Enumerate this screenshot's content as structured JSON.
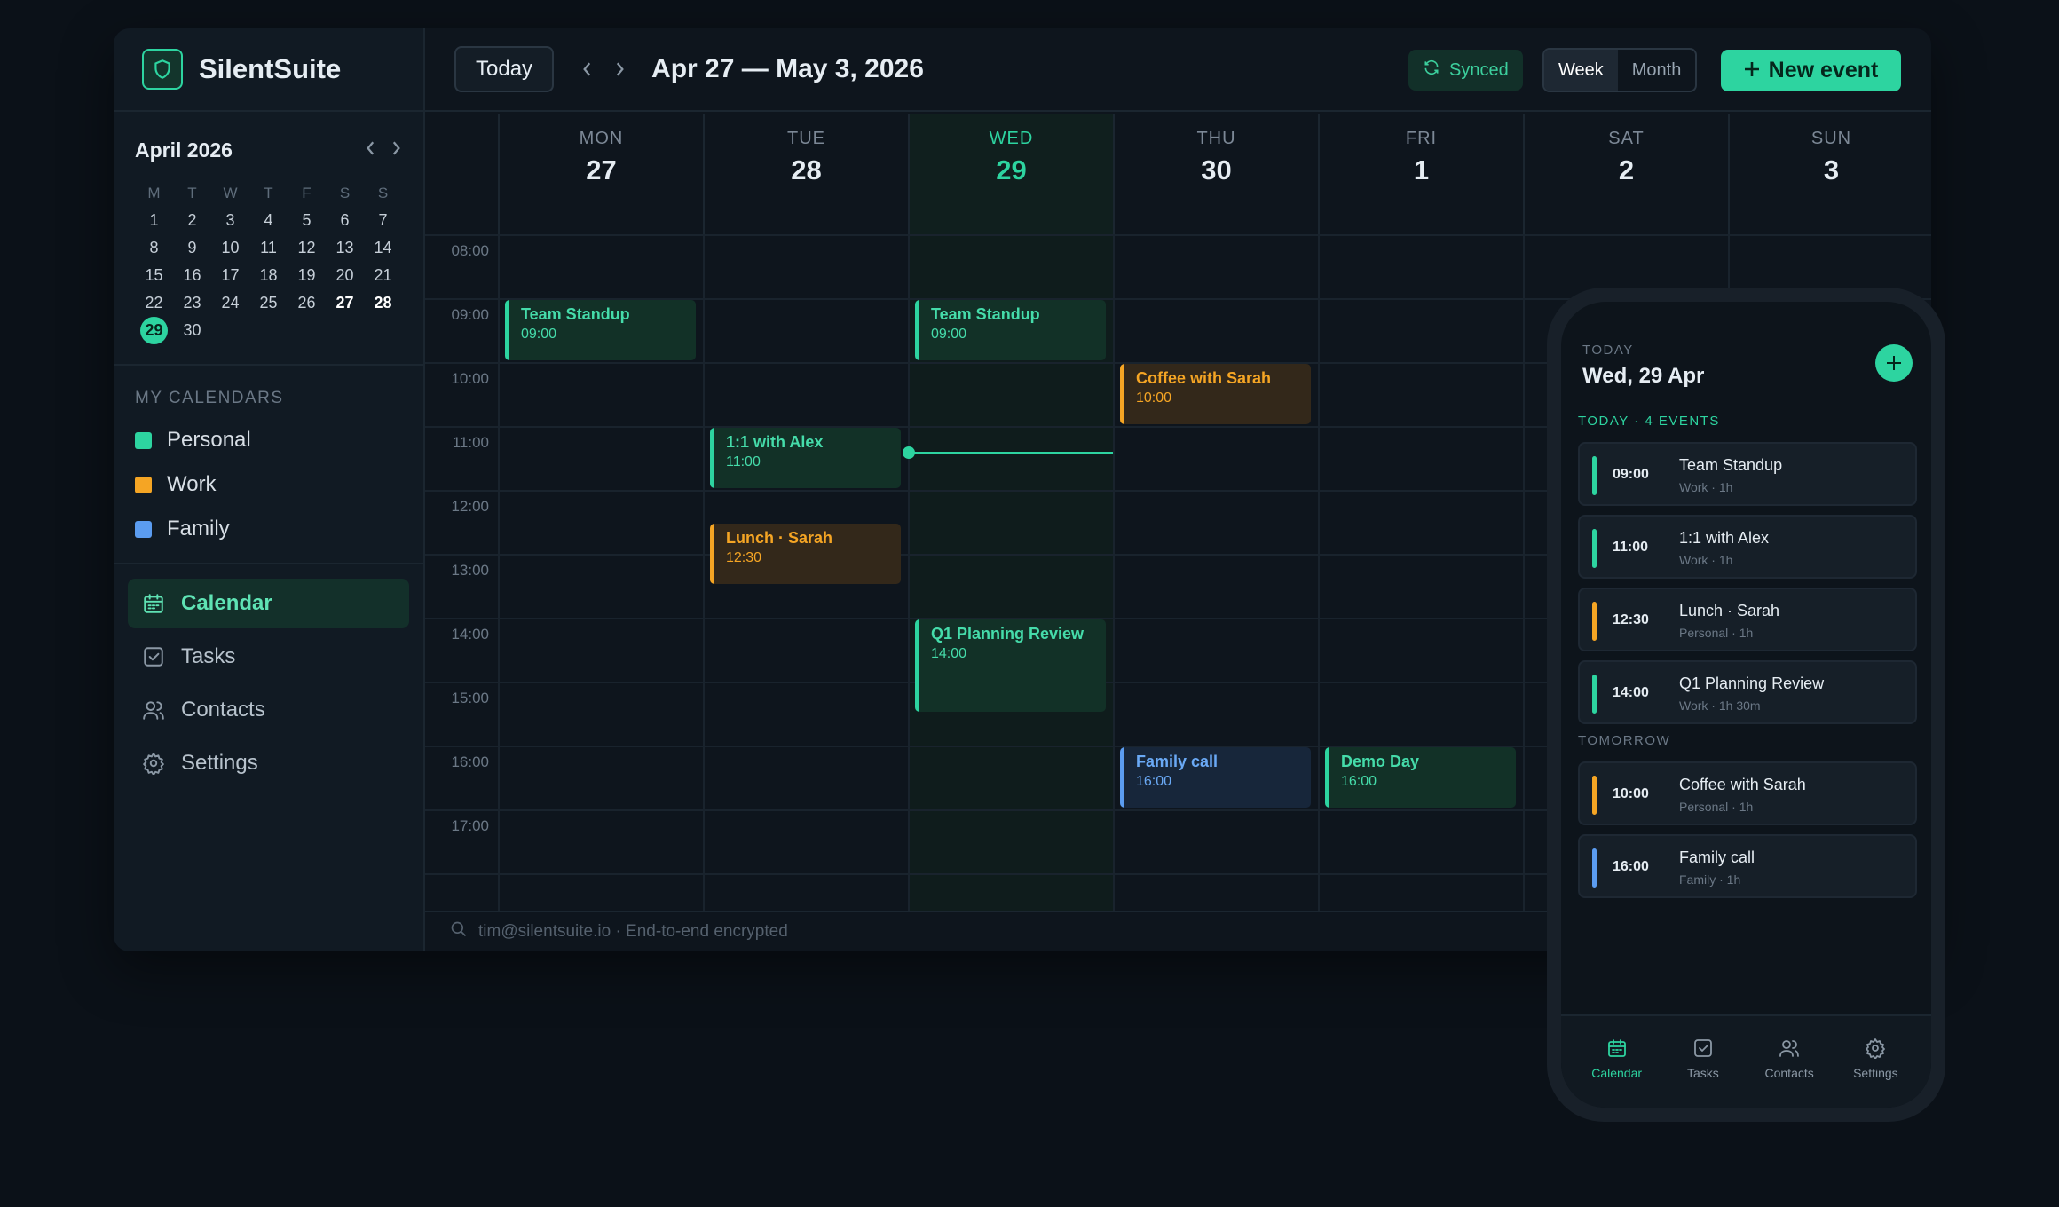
{
  "brand": {
    "name": "SilentSuite"
  },
  "mini_calendar": {
    "month": "April 2026",
    "weekdays": [
      "M",
      "T",
      "W",
      "T",
      "F",
      "S",
      "S"
    ],
    "days": [
      "1",
      "2",
      "3",
      "4",
      "5",
      "6",
      "7",
      "8",
      "9",
      "10",
      "11",
      "12",
      "13",
      "14",
      "15",
      "16",
      "17",
      "18",
      "19",
      "20",
      "21",
      "22",
      "23",
      "24",
      "25",
      "26",
      "27",
      "28",
      "29",
      "30"
    ],
    "today": "29"
  },
  "my_calendars": {
    "label": "MY CALENDARS",
    "items": [
      {
        "label": "Personal",
        "color": "#2dd4a0"
      },
      {
        "label": "Work",
        "color": "#f5a524"
      },
      {
        "label": "Family",
        "color": "#5b9cf0"
      }
    ]
  },
  "nav": {
    "items": [
      {
        "label": "Calendar",
        "icon": "calendar-icon",
        "active": true
      },
      {
        "label": "Tasks",
        "icon": "tasks-icon",
        "active": false
      },
      {
        "label": "Contacts",
        "icon": "contacts-icon",
        "active": false
      },
      {
        "label": "Settings",
        "icon": "settings-icon",
        "active": false
      }
    ]
  },
  "toolbar": {
    "today_label": "Today",
    "range_label": "Apr 27 — May 3, 2026",
    "sync_status": "Synced",
    "view_week": "Week",
    "view_month": "Month",
    "active_view": "Week",
    "new_event_label": "New event"
  },
  "week": {
    "days": [
      {
        "name": "MON",
        "date": "27"
      },
      {
        "name": "TUE",
        "date": "28"
      },
      {
        "name": "WED",
        "date": "29",
        "current": true
      },
      {
        "name": "THU",
        "date": "30"
      },
      {
        "name": "FRI",
        "date": "1"
      },
      {
        "name": "SAT",
        "date": "2"
      },
      {
        "name": "SUN",
        "date": "3"
      }
    ],
    "hours": [
      "08:00",
      "09:00",
      "10:00",
      "11:00",
      "12:00",
      "13:00",
      "14:00",
      "15:00",
      "16:00",
      "17:00"
    ],
    "events": [
      {
        "title": "Team Standup",
        "time": "09:00",
        "day": 0,
        "start": 9,
        "end": 10,
        "color": "green"
      },
      {
        "title": "Team Standup",
        "time": "09:00",
        "day": 2,
        "start": 9,
        "end": 10,
        "color": "green"
      },
      {
        "title": "Coffee with Sarah",
        "time": "10:00",
        "day": 3,
        "start": 10,
        "end": 11,
        "color": "orange"
      },
      {
        "title": "1:1 with Alex",
        "time": "11:00",
        "day": 1,
        "start": 11,
        "end": 12,
        "color": "green"
      },
      {
        "title": "Lunch · Sarah",
        "time": "12:30",
        "day": 1,
        "start": 12.5,
        "end": 13.5,
        "color": "orange"
      },
      {
        "title": "Q1 Planning Review",
        "time": "14:00",
        "day": 2,
        "start": 14,
        "end": 15.5,
        "color": "green"
      },
      {
        "title": "Family call",
        "time": "16:00",
        "day": 3,
        "start": 16,
        "end": 17,
        "color": "blue"
      },
      {
        "title": "Demo Day",
        "time": "16:00",
        "day": 4,
        "start": 16,
        "end": 17,
        "color": "green"
      }
    ],
    "now": {
      "day": 2,
      "hour": 11.4
    }
  },
  "footer": {
    "text": "tim@silentsuite.io · End-to-end encrypted"
  },
  "mobile": {
    "today_label": "TODAY",
    "date": "Wed, 29 Apr",
    "today_section": "TODAY · 4 EVENTS",
    "today_events": [
      {
        "time": "09:00",
        "title": "Team Standup",
        "meta": "Work · 1h",
        "color": "#2dd4a0"
      },
      {
        "time": "11:00",
        "title": "1:1 with Alex",
        "meta": "Work · 1h",
        "color": "#2dd4a0"
      },
      {
        "time": "12:30",
        "title": "Lunch · Sarah",
        "meta": "Personal · 1h",
        "color": "#f5a524"
      },
      {
        "time": "14:00",
        "title": "Q1 Planning Review",
        "meta": "Work · 1h 30m",
        "color": "#2dd4a0"
      }
    ],
    "tomorrow_section": "TOMORROW",
    "tomorrow_events": [
      {
        "time": "10:00",
        "title": "Coffee with Sarah",
        "meta": "Personal · 1h",
        "color": "#f5a524"
      },
      {
        "time": "16:00",
        "title": "Family call",
        "meta": "Family · 1h",
        "color": "#5b9cf0"
      }
    ],
    "tabs": [
      {
        "label": "Calendar",
        "icon": "calendar-icon",
        "active": true
      },
      {
        "label": "Tasks",
        "icon": "tasks-icon",
        "active": false
      },
      {
        "label": "Contacts",
        "icon": "contacts-icon",
        "active": false
      },
      {
        "label": "Settings",
        "icon": "settings-icon",
        "active": false
      }
    ]
  }
}
